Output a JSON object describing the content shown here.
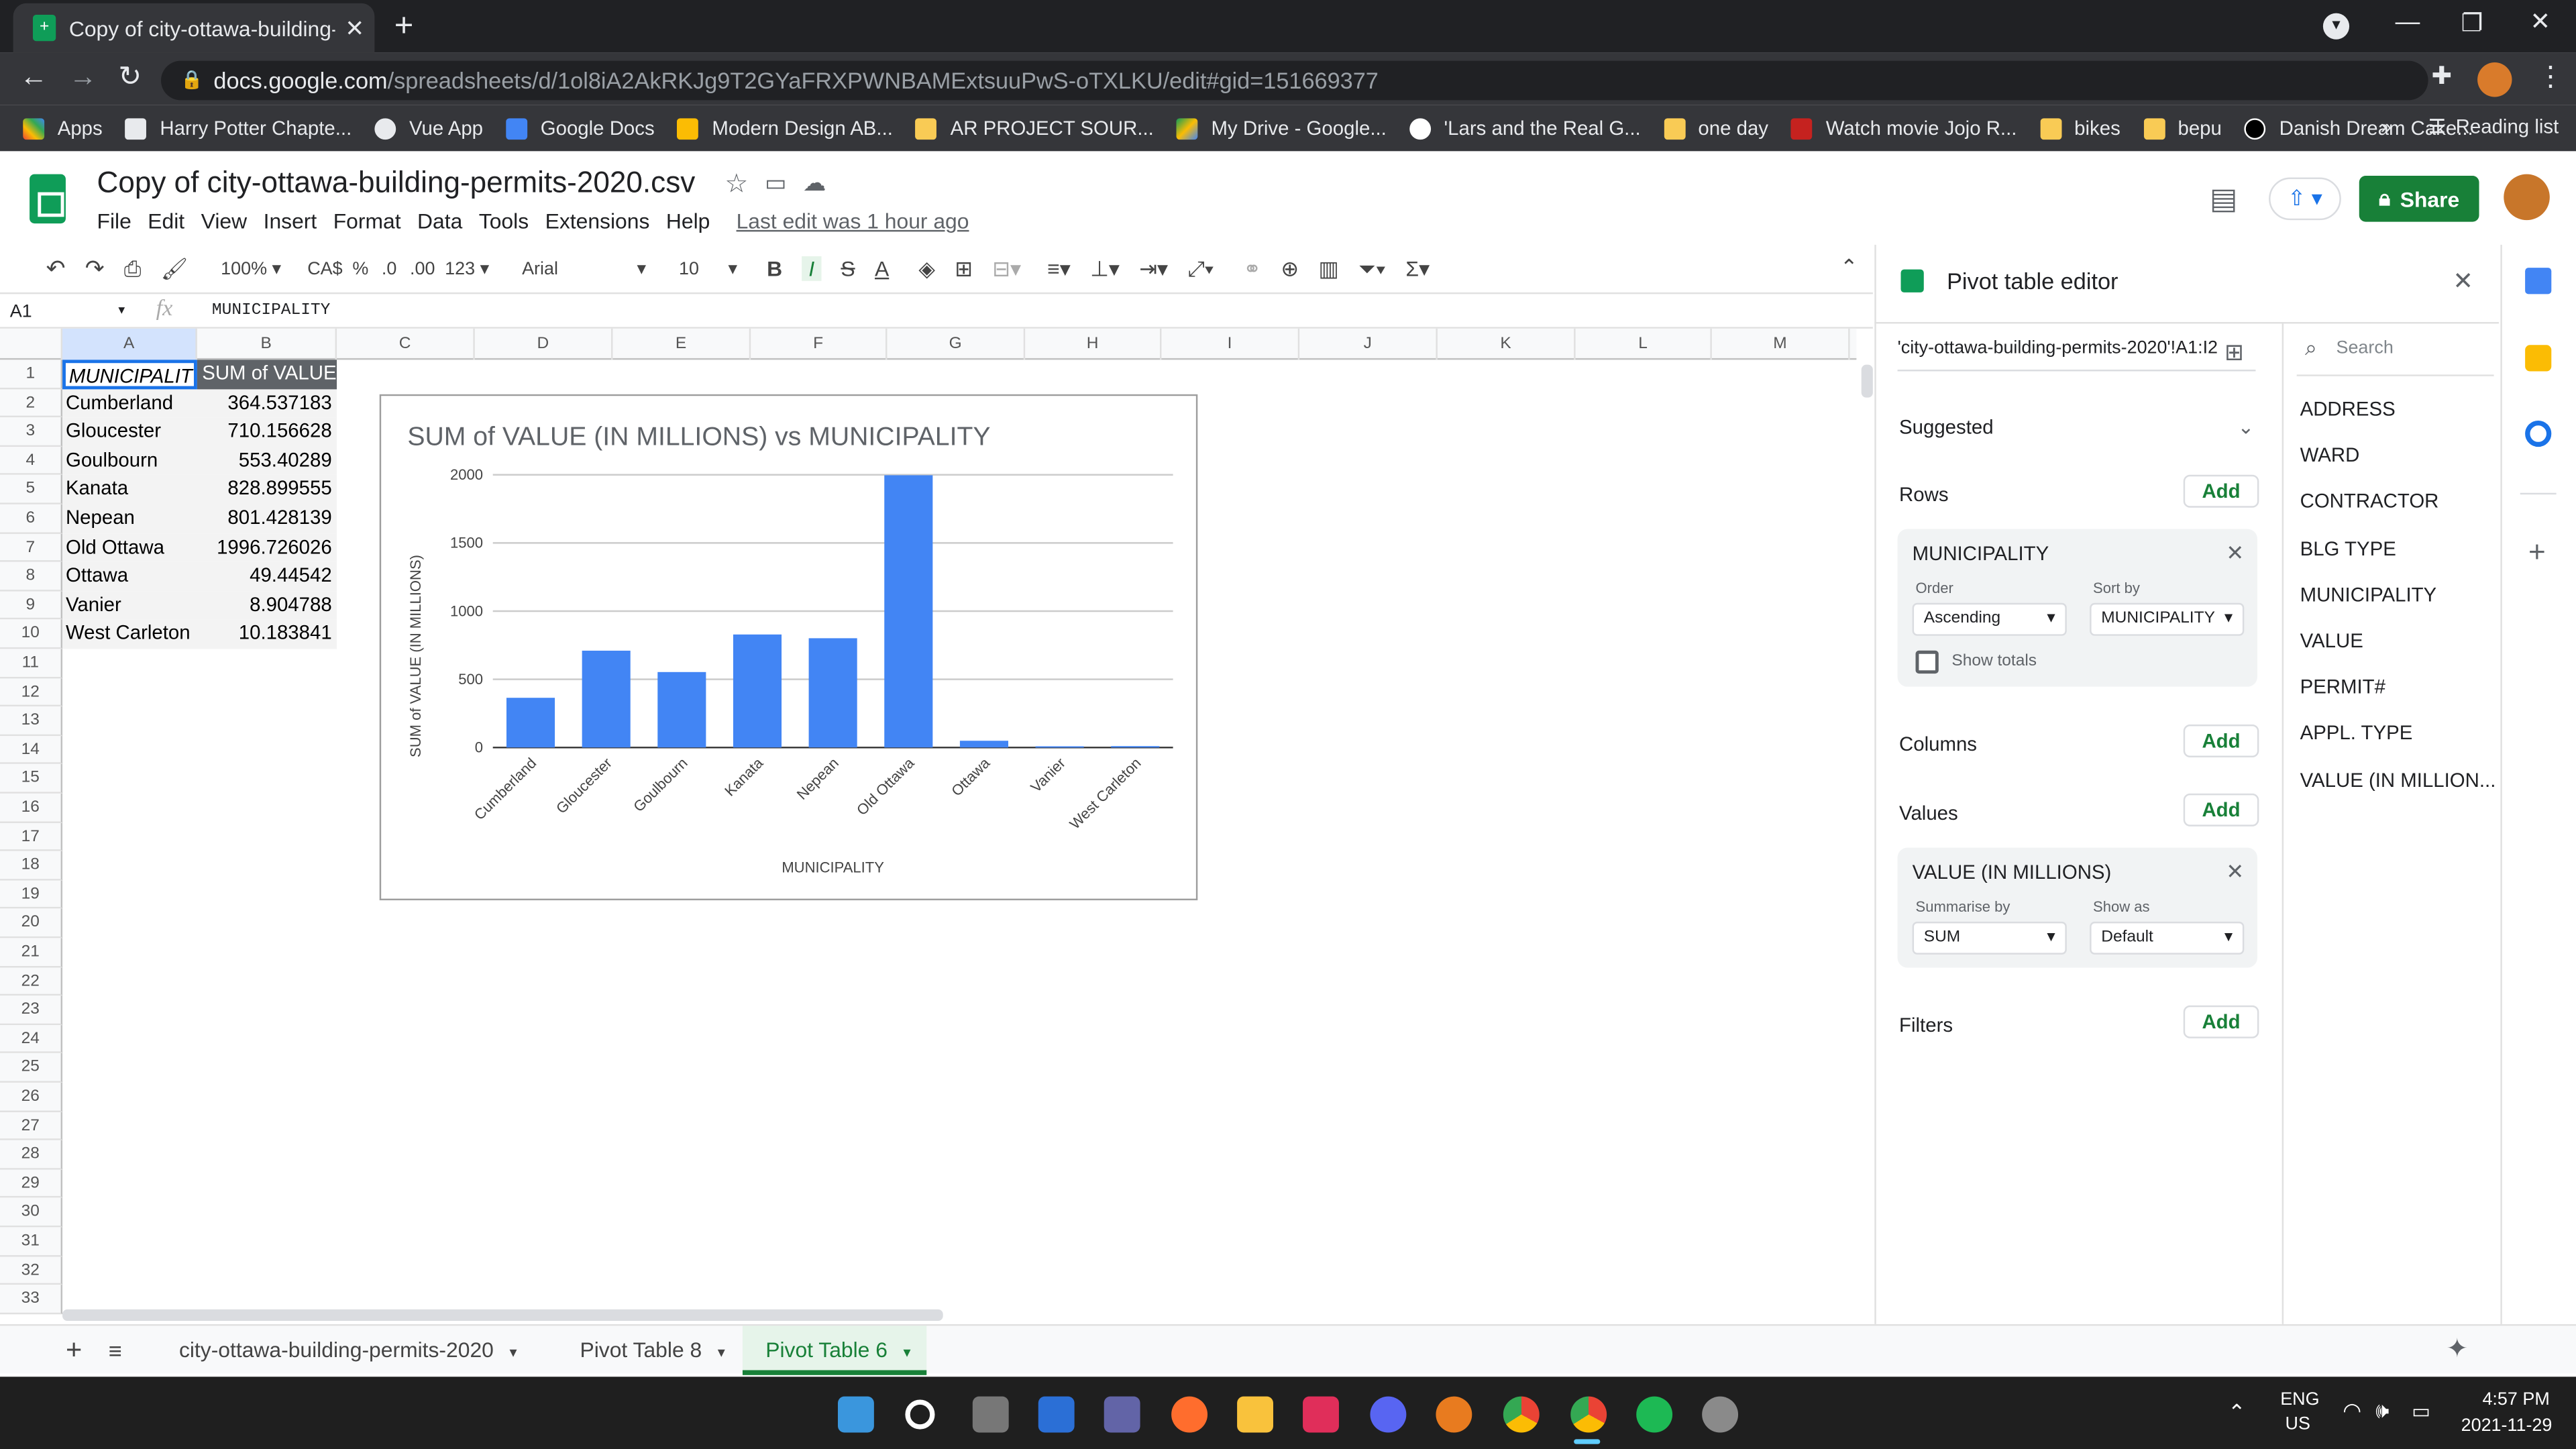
{
  "browser": {
    "tab_title": "Copy of city-ottawa-building-per",
    "url_host": "docs.google.com",
    "url_path": "/spreadsheets/d/1ol8iA2AkRKJg9T2GYaFRXPWNBAMExtsuuPwS-oTXLKU/edit#gid=151669377",
    "bookmarks": [
      "Apps",
      "Harry Potter Chapte...",
      "Vue App",
      "Google Docs",
      "Modern Design AB...",
      "AR PROJECT SOUR...",
      "My Drive - Google...",
      "'Lars and the Real G...",
      "one day",
      "Watch movie Jojo R...",
      "bikes",
      "bepu",
      "Danish Dream Cake..."
    ],
    "reading_list": "Reading list"
  },
  "sheets": {
    "doc_title": "Copy of city-ottawa-building-permits-2020.csv",
    "menus": [
      "File",
      "Edit",
      "View",
      "Insert",
      "Format",
      "Data",
      "Tools",
      "Extensions",
      "Help"
    ],
    "last_edit": "Last edit was 1 hour ago",
    "share_label": "Share",
    "toolbar": {
      "zoom": "100%",
      "currency": "CA$",
      "percent": "%",
      "dec_less": ".0",
      "dec_more": ".00",
      "format": "123",
      "font": "Arial",
      "size": "10"
    },
    "cell_ref": "A1",
    "formula": "MUNICIPALITY"
  },
  "grid": {
    "columns": [
      "A",
      "B",
      "C",
      "D",
      "E",
      "F",
      "G",
      "H",
      "I",
      "J",
      "K",
      "L",
      "M"
    ],
    "rows": [
      "1",
      "2",
      "3",
      "4",
      "5",
      "6",
      "7",
      "8",
      "9",
      "10",
      "11",
      "12",
      "13",
      "14",
      "15",
      "16",
      "17",
      "18",
      "19",
      "20",
      "21",
      "22",
      "23",
      "24",
      "25",
      "26",
      "27",
      "28",
      "29",
      "30",
      "31",
      "32",
      "33"
    ],
    "header": [
      "MUNICIPALITY",
      "SUM of VALUE ("
    ],
    "data": [
      [
        "Cumberland",
        "364.537183"
      ],
      [
        "Gloucester",
        "710.156628"
      ],
      [
        "Goulbourn",
        "553.40289"
      ],
      [
        "Kanata",
        "828.899555"
      ],
      [
        "Nepean",
        "801.428139"
      ],
      [
        "Old Ottawa",
        "1996.726026"
      ],
      [
        "Ottawa",
        "49.44542"
      ],
      [
        "Vanier",
        "8.904788"
      ],
      [
        "West Carleton",
        "10.183841"
      ]
    ]
  },
  "chart_data": {
    "type": "bar",
    "title": "SUM of VALUE (IN MILLIONS) vs MUNICIPALITY",
    "xlabel": "MUNICIPALITY",
    "ylabel": "SUM of VALUE (IN MILLIONS)",
    "categories": [
      "Cumberland",
      "Gloucester",
      "Goulbourn",
      "Kanata",
      "Nepean",
      "Old Ottawa",
      "Ottawa",
      "Vanier",
      "West Carleton"
    ],
    "values": [
      364.537183,
      710.156628,
      553.40289,
      828.899555,
      801.428139,
      1996.726026,
      49.44542,
      8.904788,
      10.183841
    ],
    "yticks": [
      "0",
      "500",
      "1000",
      "1500",
      "2000"
    ],
    "ylim": [
      0,
      2000
    ],
    "grid": true,
    "bar_color": "#4285f4"
  },
  "sheet_tabs": [
    "city-ottawa-building-permits-2020",
    "Pivot Table 8",
    "Pivot Table 6"
  ],
  "pivot": {
    "title": "Pivot table editor",
    "range": "'city-ottawa-building-permits-2020'!A1:I2",
    "suggested": "Suggested",
    "rows_label": "Rows",
    "columns_label": "Columns",
    "values_label": "Values",
    "filters_label": "Filters",
    "add": "Add",
    "row_field": "MUNICIPALITY",
    "order_label": "Order",
    "order_value": "Ascending",
    "sortby_label": "Sort by",
    "sortby_value": "MUNICIPALITY",
    "show_totals": "Show totals",
    "value_field": "VALUE (IN MILLIONS)",
    "summarise_label": "Summarise by",
    "summarise_value": "SUM",
    "showas_label": "Show as",
    "showas_value": "Default",
    "search_placeholder": "Search",
    "fields": [
      "ADDRESS",
      "WARD",
      "CONTRACTOR",
      "BLG TYPE",
      "MUNICIPALITY",
      "VALUE",
      "PERMIT#",
      "APPL. TYPE",
      "VALUE (IN MILLION..."
    ]
  },
  "taskbar": {
    "lang1": "ENG",
    "lang2": "US",
    "time": "4:57 PM",
    "date": "2021-11-29"
  }
}
